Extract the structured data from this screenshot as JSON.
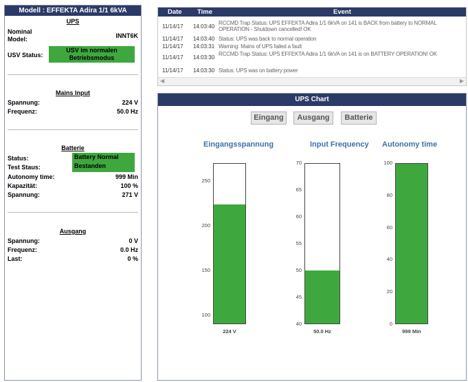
{
  "left_panel": {
    "title": "Modell : EFFEKTA Adira 1/1 6kVA",
    "ups": {
      "heading": "UPS",
      "model_label": "Nominal Model:",
      "model_value": "INNT6K",
      "status_label": "USV Status:",
      "status_value": "USV im normalen Betriebsmodus"
    },
    "mains_input": {
      "heading": "Mains Input",
      "rows": [
        {
          "label": "Spannung:",
          "value": "224 V"
        },
        {
          "label": "Frequenz:",
          "value": "50.0 Hz"
        }
      ]
    },
    "batterie": {
      "heading": "Batterie",
      "status_label": "Status:",
      "status_value": "Battery Normal",
      "test_label": "Test Staus:",
      "test_value": "Bestanden",
      "rows": [
        {
          "label": "Autonomy time:",
          "value": "999 Min"
        },
        {
          "label": "Kapazität:",
          "value": "100 %"
        },
        {
          "label": "Spannung:",
          "value": "271 V"
        }
      ]
    },
    "ausgang": {
      "heading": "Ausgang",
      "rows": [
        {
          "label": "Spannung:",
          "value": "0 V"
        },
        {
          "label": "Frequenz:",
          "value": "0.0 Hz"
        },
        {
          "label": "Last:",
          "value": "0 %"
        }
      ]
    }
  },
  "events": {
    "headers": {
      "date": "Date",
      "time": "Time",
      "event": "Event"
    },
    "rows": [
      {
        "date": "11/14/17",
        "time": "14:03:40",
        "event": "RCCMD Trap Status: UPS EFFEKTA Adira 1/1 6kVA on 141 is BACK from battery to NORMAL OPERATION - Shutdown cancelled! OK"
      },
      {
        "date": "11/14/17",
        "time": "14:03:40",
        "event": "Status: UPS was back to normal operation"
      },
      {
        "date": "11/14/17",
        "time": "14:03:31",
        "event": "Warning: Mains of UPS failed a fault"
      },
      {
        "date": "11/14/17",
        "time": "14:03:30",
        "event": "RCCMD Trap Status: UPS EFFEKTA Adira 1/1 6kVA on 141 is on BATTERY OPERATION! OK"
      },
      {
        "date": "11/14/17",
        "time": "14:03:30",
        "event": "Status: UPS was on battery power"
      }
    ]
  },
  "chart_panel": {
    "title": "UPS Chart",
    "buttons": [
      "Eingang",
      "Ausgang",
      "Batterie"
    ],
    "bar_color": "#3ea83f",
    "header_color": "#2b3a67"
  },
  "chart_data": [
    {
      "type": "bar",
      "title": "Eingangsspannung",
      "categories": [
        "224 V"
      ],
      "values": [
        224
      ],
      "ylim": [
        90,
        270
      ],
      "ticks": [
        100,
        150,
        200,
        250
      ],
      "value_label": "224 V"
    },
    {
      "type": "bar",
      "title": "Input Frequency",
      "categories": [
        "50.0 Hz"
      ],
      "values": [
        50.0
      ],
      "ylim": [
        40,
        70
      ],
      "ticks": [
        40,
        45,
        50,
        55,
        60,
        65,
        70
      ],
      "value_label": "50.0 Hz"
    },
    {
      "type": "bar",
      "title": "Autonomy time",
      "categories": [
        "999 Min"
      ],
      "values": [
        100
      ],
      "ylim": [
        0,
        100
      ],
      "ticks": [
        0,
        20,
        40,
        60,
        80,
        100
      ],
      "value_label": "999 Min"
    }
  ]
}
